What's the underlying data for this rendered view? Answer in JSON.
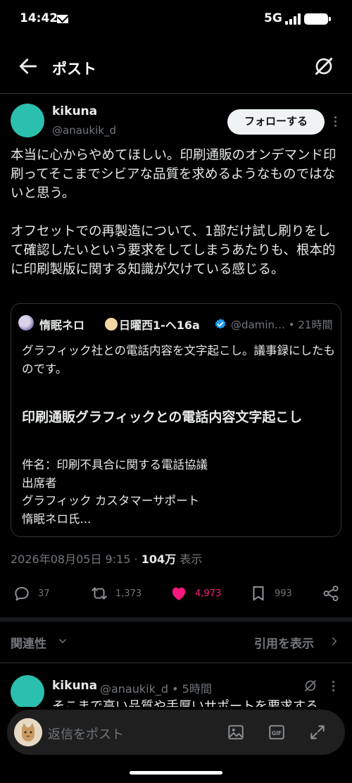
{
  "status_bar": {
    "time": "14:42",
    "network": "5G"
  },
  "header": {
    "title": "ポスト"
  },
  "post": {
    "author_name": "kikuna",
    "author_handle": "@anaukik_d",
    "follow_label": "フォローする",
    "text": "本当に心からやめてほしい。印刷通販のオンデマンド印刷ってそこまでシビアな品質を求めるようなものではないと思う。\n\nオフセットでの再製造について、1部だけ試し刷りをして確認したいという要求をしてしまうあたりも、根本的に印刷製版に関する知識が欠けている感じる。",
    "timestamp": "2026年08月05日 9:15",
    "separator": " · ",
    "views_count": "104万",
    "views_label": " 表示"
  },
  "quoted_post": {
    "name_part1": "惰眠ネロ",
    "name_part2": "日曜西1-ヘ16a",
    "handle_time": "@damin… • 21時間",
    "text": "グラフィック社との電話内容を文字起こし。議事録にしたものです。",
    "article_title": "印刷通販グラフィックとの電話内容文字起こし",
    "article_lines": [
      "件名：印刷不具合に関する電話協議",
      "出席者",
      "グラフィック カスタマーサポート",
      "惰眠ネロ氏..."
    ]
  },
  "actions": {
    "replies": "37",
    "reposts": "1,373",
    "likes": "4,973",
    "bookmarks": "993"
  },
  "sort": {
    "label": "関連性",
    "quotes_label": "引用を表示"
  },
  "reply": {
    "author_name": "kikuna",
    "handle_time": "@anaukik_d • 5時間",
    "text": "そこまで高い品質や手厚いサポートを要求する"
  },
  "composer": {
    "placeholder": "返信をポスト"
  },
  "colors": {
    "accent_like": "#f91880",
    "verified": "#1d9bf0",
    "avatar": "#2bbfae"
  }
}
